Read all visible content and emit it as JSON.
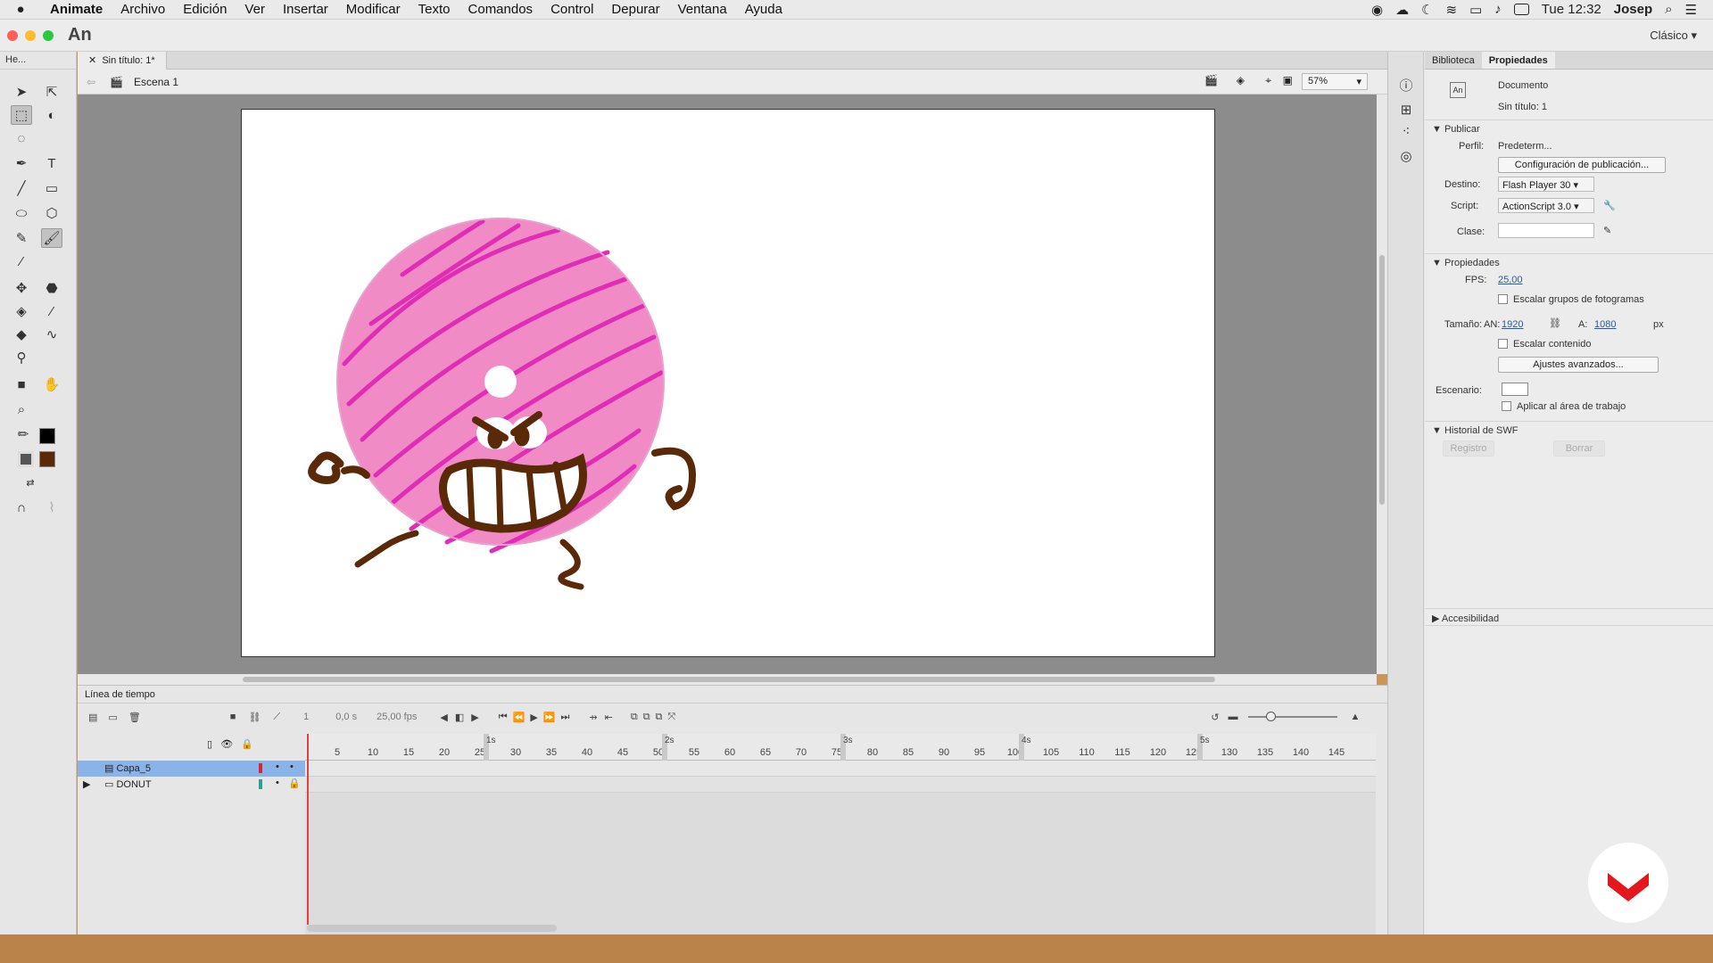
{
  "menubar": {
    "app": "Animate",
    "items": [
      "Archivo",
      "Edición",
      "Ver",
      "Insertar",
      "Modificar",
      "Texto",
      "Comandos",
      "Control",
      "Depurar",
      "Ventana",
      "Ayuda"
    ],
    "clock": "Tue 12:32",
    "user": "Josep"
  },
  "appbar": {
    "logo": "An",
    "workspace": "Clásico ▾"
  },
  "tools": {
    "header": "He..."
  },
  "doc": {
    "tab": "Sin título: 1*",
    "scene": "Escena 1",
    "zoom": "57%"
  },
  "timeline": {
    "title": "Línea de tiempo",
    "frame": "1",
    "time": "0,0 s",
    "fps": "25,00 fps",
    "ruler_seconds": [
      "1s",
      "2s",
      "3s",
      "4s",
      "5s"
    ],
    "ruler_ticks": [
      "5",
      "10",
      "15",
      "20",
      "25",
      "30",
      "35",
      "40",
      "45",
      "50",
      "55",
      "60",
      "65",
      "70",
      "75",
      "80",
      "85",
      "90",
      "95",
      "100",
      "105",
      "110",
      "115",
      "120",
      "125",
      "130",
      "135",
      "140",
      "145"
    ],
    "layers": [
      {
        "name": "Capa_5",
        "color": "#d8243a",
        "selected": true
      },
      {
        "name": "DONUT",
        "color": "#2e9e8e",
        "selected": false
      }
    ]
  },
  "props": {
    "tabs": [
      "Biblioteca",
      "Propiedades"
    ],
    "doc_type": "Documento",
    "doc_name": "Sin título: 1",
    "publicar": "Publicar",
    "perfil_label": "Perfil:",
    "perfil_val": "Predeterm...",
    "pub_btn": "Configuración de publicación...",
    "destino_label": "Destino:",
    "destino_val": "Flash Player 30",
    "script_label": "Script:",
    "script_val": "ActionScript 3.0",
    "clase_label": "Clase:",
    "propiedades": "Propiedades",
    "fps_label": "FPS:",
    "fps_val": "25,00",
    "escalar_grupos": "Escalar grupos de fotogramas",
    "tam_label": "Tamaño:",
    "an_label": "AN:",
    "an_val": "1920",
    "a_label": "A:",
    "a_val": "1080",
    "px": "px",
    "escalar_contenido": "Escalar contenido",
    "ajustes_btn": "Ajustes avanzados...",
    "escenario_label": "Escenario:",
    "aplicar": "Aplicar al área de trabajo",
    "historial": "Historial de SWF",
    "registro": "Registro",
    "borrar": "Borrar",
    "accesibilidad": "Accesibilidad"
  },
  "colors": {
    "donut": "#f08bc6",
    "sprinkles": "#e02db5",
    "ink": "#5a2a08"
  }
}
